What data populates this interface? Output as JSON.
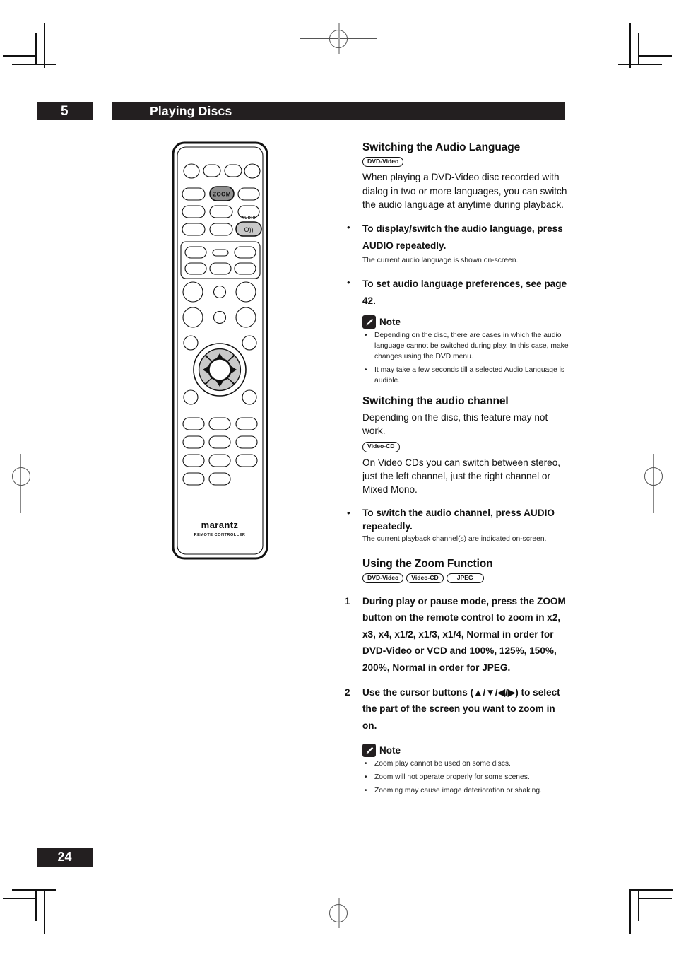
{
  "header": {
    "chapter_number": "5",
    "chapter_title": "Playing Discs"
  },
  "footer": {
    "page_number": "24"
  },
  "remote": {
    "brand": "marantz",
    "brand_sub": "REMOTE CONTROLLER",
    "zoom_button_label": "ZOOM",
    "audio_button_caption": "AUDIO",
    "audio_button_glyph": "O))"
  },
  "sections": [
    {
      "id": "audio-language",
      "heading": "Switching the Audio Language",
      "badges": [
        "DVD-Video"
      ],
      "intro": "When playing a DVD-Video disc recorded with dialog in two or more languages, you can switch the audio language at anytime during playback.",
      "bullets": [
        {
          "dot": "•",
          "text": "To display/switch the audio language, press AUDIO repeatedly.",
          "sub": "The current audio language is shown on-screen."
        },
        {
          "dot": "•",
          "text": "To set audio language preferences, see page 42.",
          "sub": ""
        }
      ],
      "note": {
        "label": "Note",
        "items": [
          "Depending on the disc, there are cases in which the audio language cannot be switched during play.  In this case, make changes using the DVD menu.",
          "It may take a few seconds till a selected Audio Language is audible."
        ]
      }
    },
    {
      "id": "audio-channel",
      "heading": "Switching the audio channel",
      "intro": "Depending on the disc, this feature may not work.",
      "badges": [
        "Video-CD"
      ],
      "body": "On Video CDs you can switch between stereo, just the left channel, just the right channel or Mixed Mono.",
      "bullets": [
        {
          "dot": "•",
          "text": "To switch the audio channel, press AUDIO repeatedly.",
          "sub": "The current playback channel(s) are indicated on-screen."
        }
      ]
    },
    {
      "id": "zoom-function",
      "heading": "Using the Zoom Function",
      "badges": [
        "DVD-Video",
        "Video-CD",
        "JPEG"
      ],
      "steps": [
        {
          "num": "1",
          "text": "During play or pause mode, press the ZOOM button on the remote control to zoom in x2, x3, x4, x1/2, x1/3, x1/4, Normal in order for DVD-Video or VCD and 100%, 125%, 150%, 200%, Normal in order for JPEG."
        },
        {
          "num": "2",
          "text": "Use the cursor buttons (▲/▼/◀/▶) to select the part of the screen you want to zoom in on."
        }
      ],
      "note": {
        "label": "Note",
        "items": [
          "Zoom play cannot be used on some discs.",
          "Zoom will not operate properly for some scenes.",
          "Zooming may cause image deterioration or shaking."
        ]
      }
    }
  ],
  "colors": {
    "ink": "#231f20",
    "button_fill": "#d9d9d9",
    "zoom_fill": "#8c8c8c"
  }
}
